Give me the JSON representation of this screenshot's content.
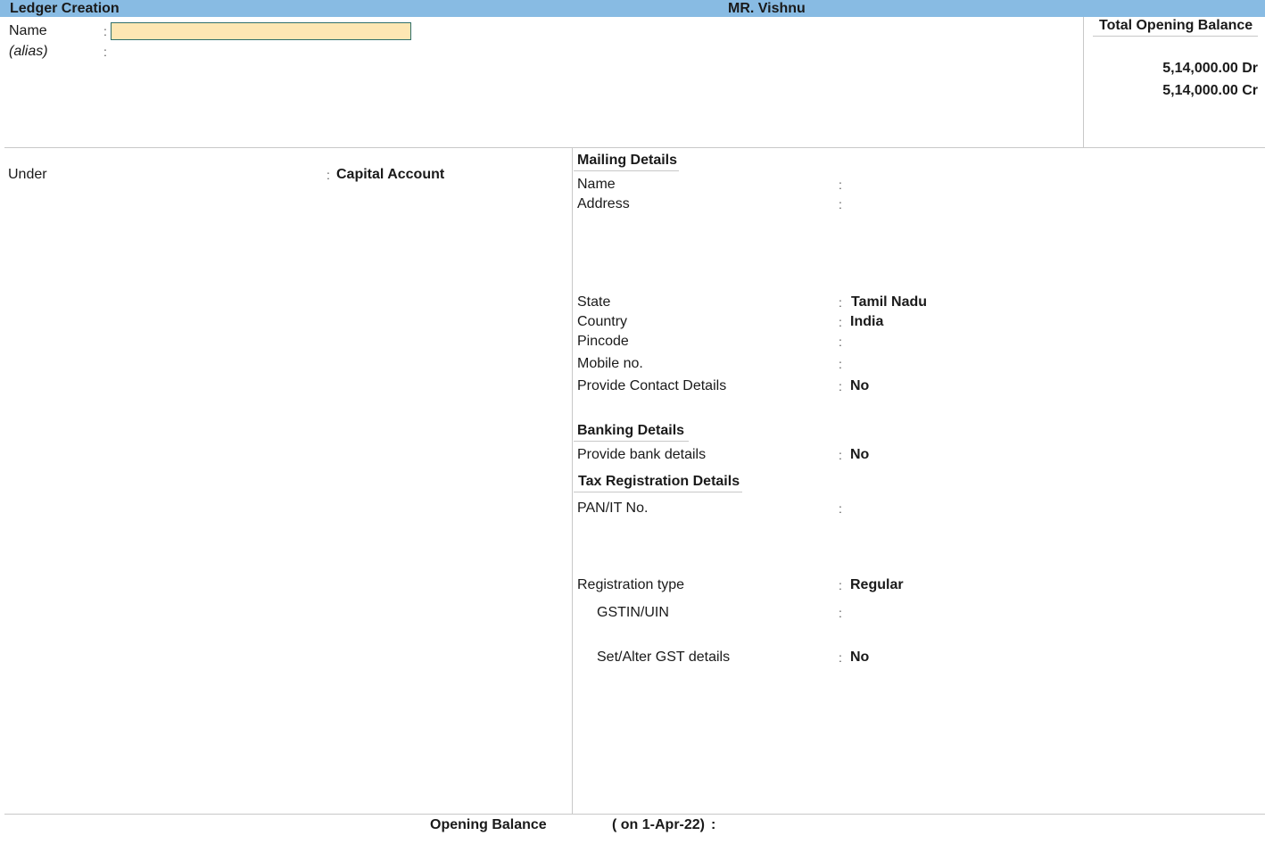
{
  "titlebar": {
    "screen_title": "Ledger Creation",
    "company_name": "MR. Vishnu",
    "color": "#88bbe3"
  },
  "ledger": {
    "name_label": "Name",
    "name_value": "",
    "alias_label": "(alias)",
    "alias_value": "",
    "separator": ":",
    "under_label": "Under",
    "under_value": "Capital Account"
  },
  "total_opening_balance": {
    "title": "Total Opening Balance",
    "debit": "5,14,000.00 Dr",
    "credit": "5,14,000.00 Cr"
  },
  "mailing_details": {
    "heading": "Mailing Details",
    "fields": [
      {
        "label": "Name",
        "value": ""
      },
      {
        "label": "Address",
        "value": ""
      },
      {
        "label": "State",
        "value": "Tamil Nadu"
      },
      {
        "label": "Country",
        "value": "India"
      },
      {
        "label": "Pincode",
        "value": ""
      },
      {
        "label": "Mobile no.",
        "value": ""
      },
      {
        "label": "Provide Contact Details",
        "value": "No"
      }
    ]
  },
  "banking_details": {
    "heading": "Banking Details",
    "fields": [
      {
        "label": "Provide bank details",
        "value": "No"
      }
    ]
  },
  "tax_registration_details": {
    "heading": "Tax Registration Details",
    "fields": [
      {
        "label": "PAN/IT No.",
        "value": ""
      },
      {
        "label": "Registration type",
        "value": "Regular"
      },
      {
        "label": "GSTIN/UIN",
        "value": ""
      },
      {
        "label": "Set/Alter GST details",
        "value": "No"
      }
    ]
  },
  "footer": {
    "opening_balance_label": "Opening Balance",
    "opening_balance_date": "( on 1-Apr-22)",
    "separator": ":",
    "opening_balance_value": ""
  }
}
